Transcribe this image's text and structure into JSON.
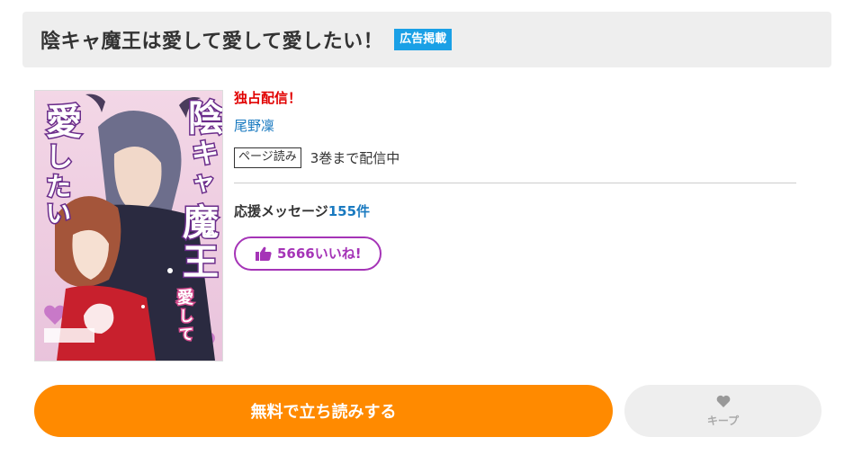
{
  "header": {
    "title": "陰キャ魔王は愛して愛して愛したい！",
    "ad_badge": "広告掲載"
  },
  "cover": {
    "title_art_text": "陰キャな魔王は愛して愛して愛したい！",
    "author_on_cover": "尾野凜"
  },
  "book": {
    "exclusive_label": "独占配信！",
    "author": "尾野凜",
    "format_badge": "ページ読み",
    "volumes_text": "3巻まで配信中",
    "cheer_label": "応援メッセージ",
    "cheer_count": "155件",
    "like_text": "5666いいね!"
  },
  "actions": {
    "read_label": "無料で立ち読みする",
    "keep_label": "キープ"
  },
  "icons": {
    "like": "thumbs-up-icon",
    "keep": "heart-icon"
  },
  "colors": {
    "ad_badge": "#1aa0e6",
    "exclusive": "#e10000",
    "link": "#1a7ac0",
    "like": "#a534b7",
    "read_button": "#ff8a00",
    "keep_button": "#eeeeee"
  }
}
